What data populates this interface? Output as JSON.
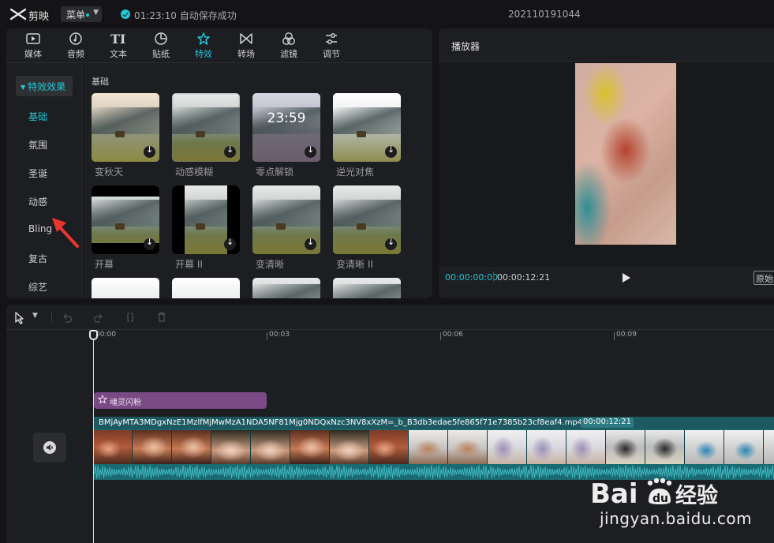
{
  "app": {
    "name": "剪映",
    "menu_label": "菜单",
    "save_status": "01:23:10 自动保存成功",
    "project_title": "202110191044"
  },
  "toolbar": {
    "tabs": [
      {
        "label": "媒体",
        "icon": "media-icon"
      },
      {
        "label": "音频",
        "icon": "audio-icon"
      },
      {
        "label": "文本",
        "icon": "text-icon"
      },
      {
        "label": "贴纸",
        "icon": "sticker-icon"
      },
      {
        "label": "特效",
        "icon": "effects-icon",
        "active": true
      },
      {
        "label": "转场",
        "icon": "transition-icon"
      },
      {
        "label": "滤镜",
        "icon": "filter-icon"
      },
      {
        "label": "调节",
        "icon": "adjust-icon"
      }
    ]
  },
  "effects_panel": {
    "category_header": "特效效果",
    "categories": [
      "基础",
      "氛围",
      "圣诞",
      "动感",
      "Bling",
      "复古",
      "综艺"
    ],
    "active_category": "基础",
    "section_title": "基础",
    "items": [
      {
        "label": "变秋天"
      },
      {
        "label": "动感模糊"
      },
      {
        "label": "零点解锁",
        "overlay": "23:59"
      },
      {
        "label": "逆光对焦"
      },
      {
        "label": "开幕"
      },
      {
        "label": "开幕 II"
      },
      {
        "label": "变清晰"
      },
      {
        "label": "变清晰 II"
      }
    ]
  },
  "player": {
    "title": "播放器",
    "current_time": "00:00:00:00",
    "total_time": "00:00:12:21",
    "ratio_label": "原始"
  },
  "timeline": {
    "ruler_labels": [
      "00:00",
      "00:03",
      "00:06",
      "00:09"
    ],
    "effect_clip_label": "魂灵闪粉",
    "video_clip_name": "BMjAyMTA3MDgxNzE1MzlfMjMwMzA1NDA5NF81Mjg0NDQxNzc3NV8xXzM=_b_B3db3edae5fe865f71e7385b23cf8eaf4.mp4",
    "video_clip_duration": "00:00:12:21"
  },
  "watermark": {
    "brand": "Baidu经验",
    "url": "jingyan.baidu.com"
  },
  "colors": {
    "accent": "#22c6d8",
    "effect_clip": "#7a4a85",
    "video_clip": "#1a6a72",
    "annotation_arrow": "#e8352f"
  }
}
